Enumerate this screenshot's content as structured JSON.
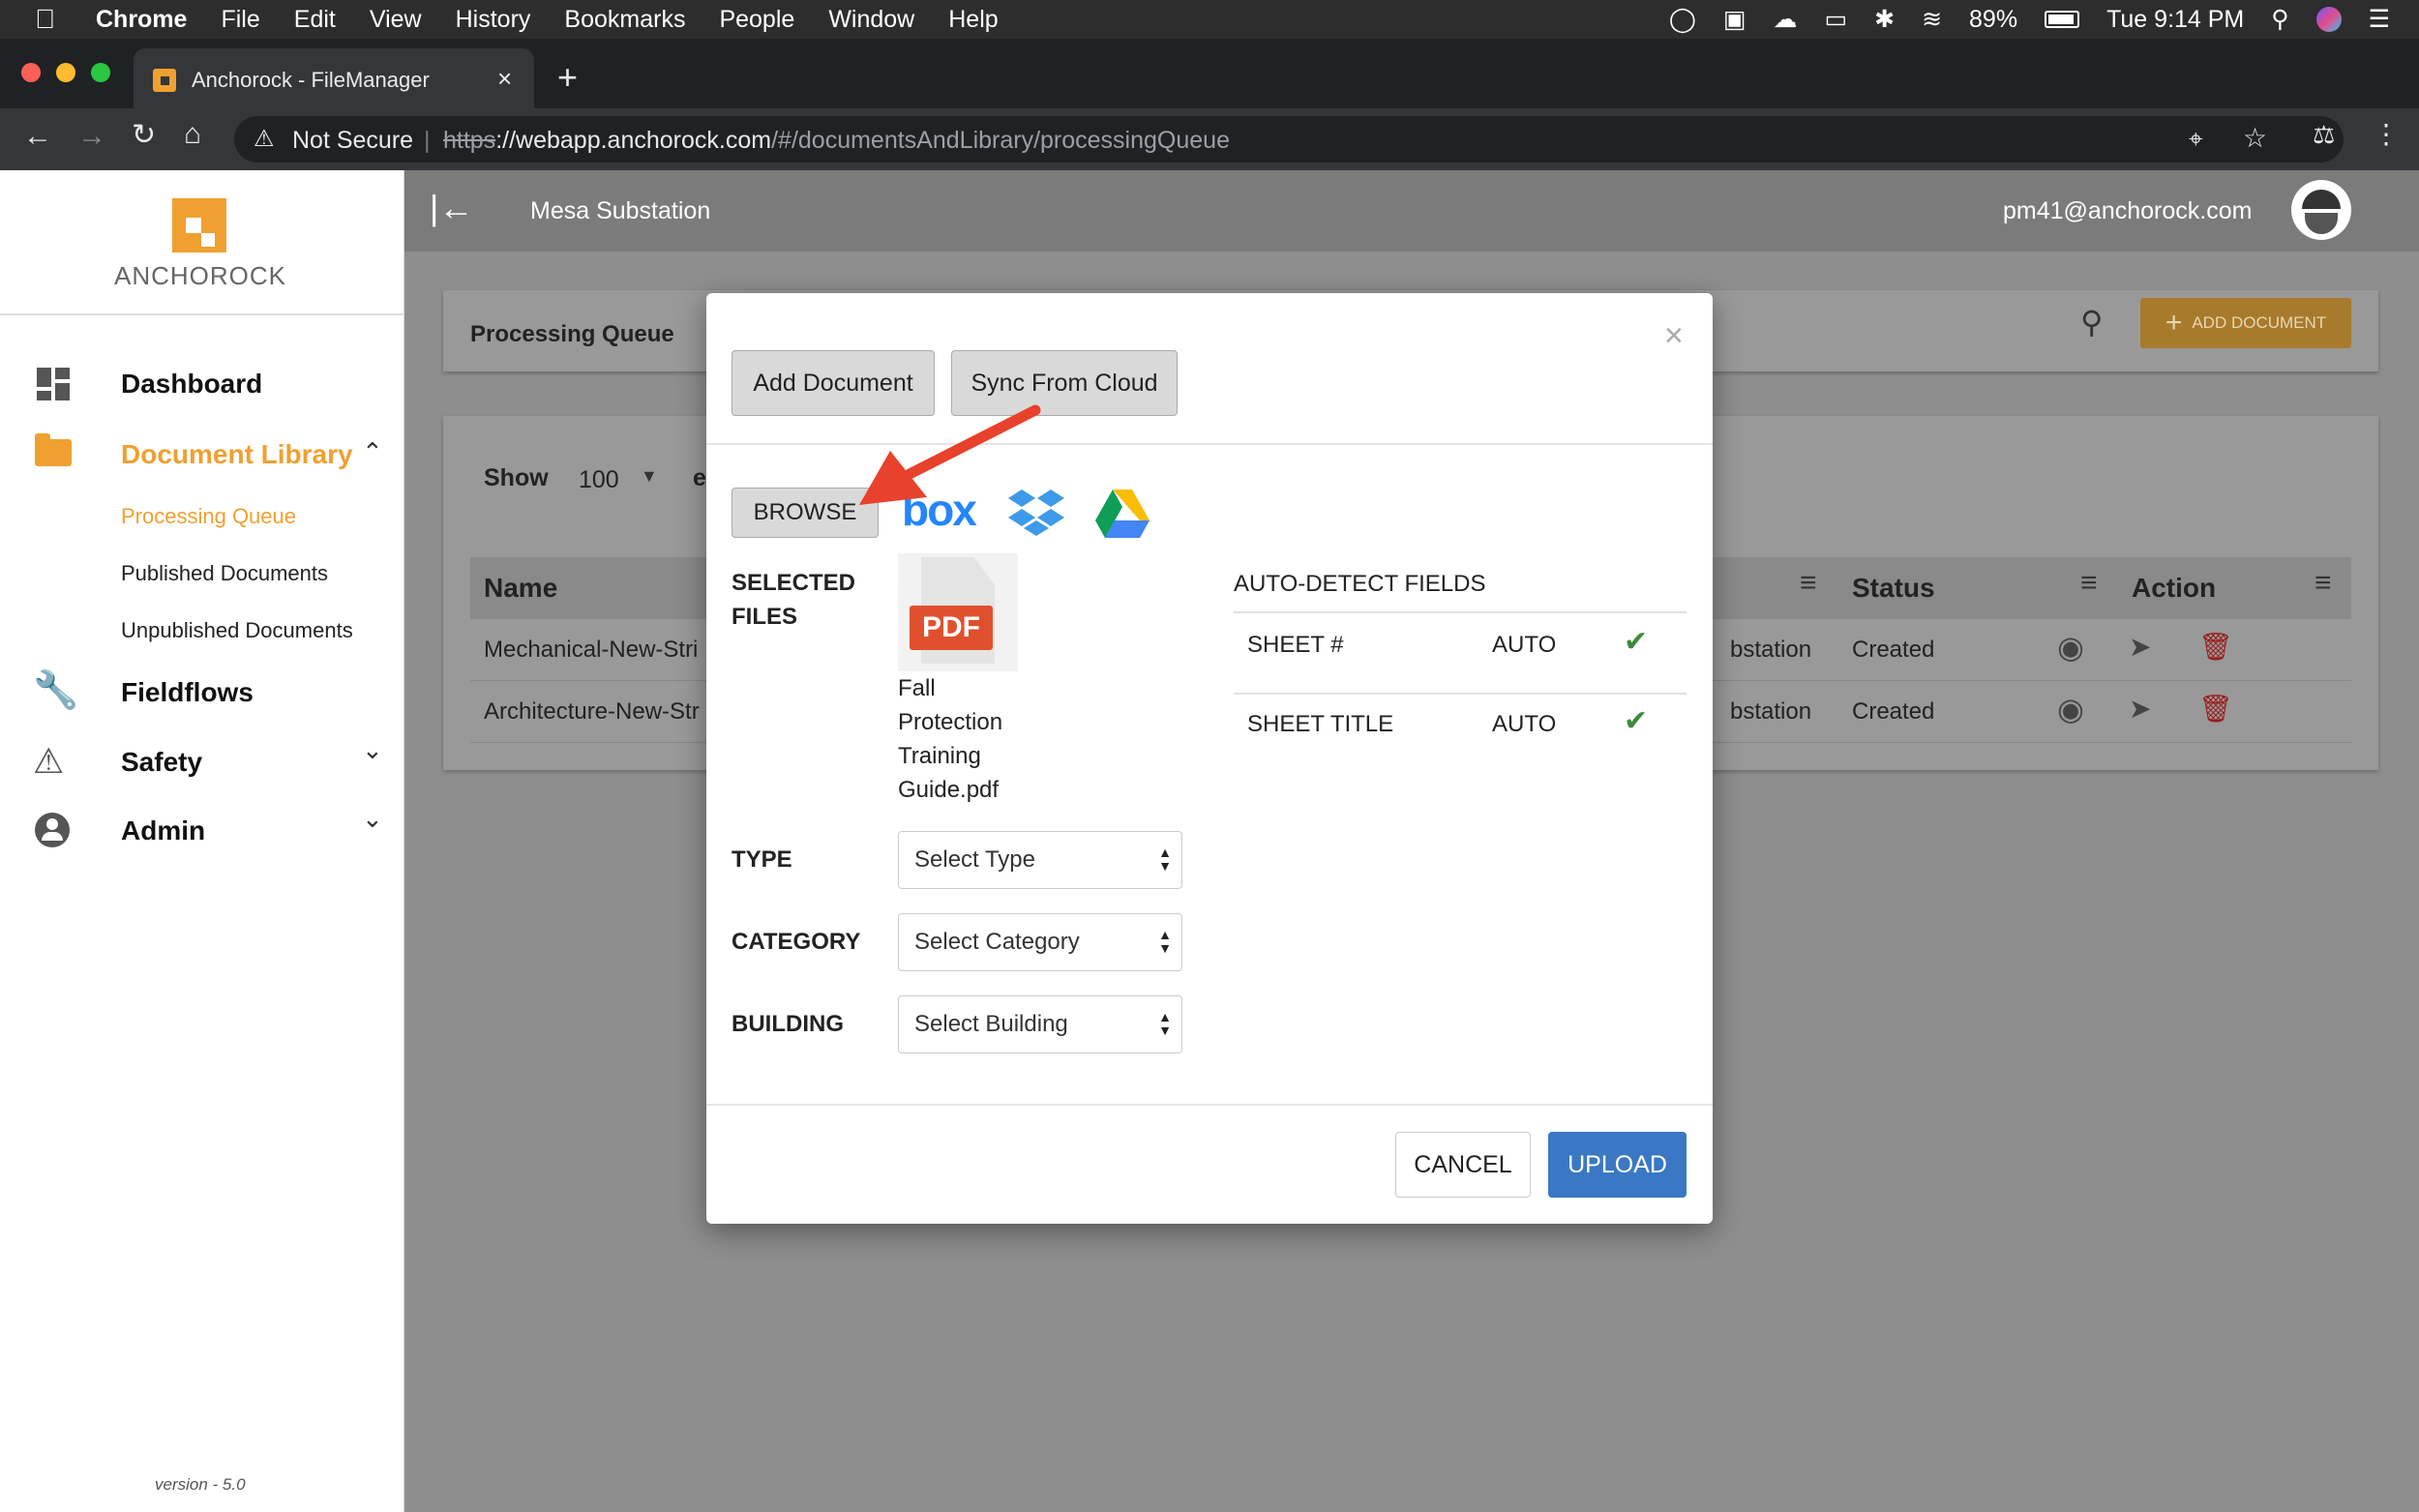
{
  "menubar": {
    "app": "Chrome",
    "items": [
      "File",
      "Edit",
      "View",
      "History",
      "Bookmarks",
      "People",
      "Window",
      "Help"
    ],
    "battery": "89%",
    "clock": "Tue 9:14 PM"
  },
  "tab": {
    "title": "Anchorock - FileManager"
  },
  "address": {
    "security": "Not Secure",
    "scheme": "https",
    "host": "://webapp.anchorock.com",
    "path": "/#/documentsAndLibrary/processingQueue"
  },
  "app": {
    "logo_text": "ANCHOROCK",
    "project": "Mesa Substation",
    "user_email": "pm41@anchorock.com",
    "version": "version - 5.0",
    "accent": "#f0a030"
  },
  "sidebar": {
    "dashboard": "Dashboard",
    "document_library": "Document Library",
    "processing_queue": "Processing Queue",
    "published": "Published Documents",
    "unpublished": "Unpublished Documents",
    "fieldflows": "Fieldflows",
    "safety": "Safety",
    "admin": "Admin"
  },
  "page": {
    "title": "Processing Queue",
    "add_document_btn": "ADD DOCUMENT",
    "show_label": "Show",
    "show_value": "100",
    "entries_partial": "e",
    "columns": [
      "Name",
      "Status",
      "Action"
    ],
    "rows": [
      {
        "name": "Mechanical-New-Stri",
        "project": "bstation",
        "status": "Created"
      },
      {
        "name": "Architecture-New-Str",
        "project": "bstation",
        "status": "Created"
      }
    ]
  },
  "modal": {
    "close": "×",
    "add_document": "Add Document",
    "sync_cloud": "Sync From Cloud",
    "browse": "BROWSE",
    "box_logo": "box",
    "selected_files_label_1": "SELECTED",
    "selected_files_label_2": "FILES",
    "pdf_badge": "PDF",
    "file_name_lines": [
      "Fall",
      "Protection",
      "Training",
      "Guide.pdf"
    ],
    "type_label": "TYPE",
    "type_value": "Select Type",
    "category_label": "CATEGORY",
    "category_value": "Select Category",
    "building_label": "BUILDING",
    "building_value": "Select Building",
    "auto_detect_title": "AUTO-DETECT FIELDS",
    "fields": [
      {
        "name": "SHEET #",
        "mode": "AUTO"
      },
      {
        "name": "SHEET TITLE",
        "mode": "AUTO"
      }
    ],
    "cancel": "CANCEL",
    "upload": "UPLOAD"
  }
}
